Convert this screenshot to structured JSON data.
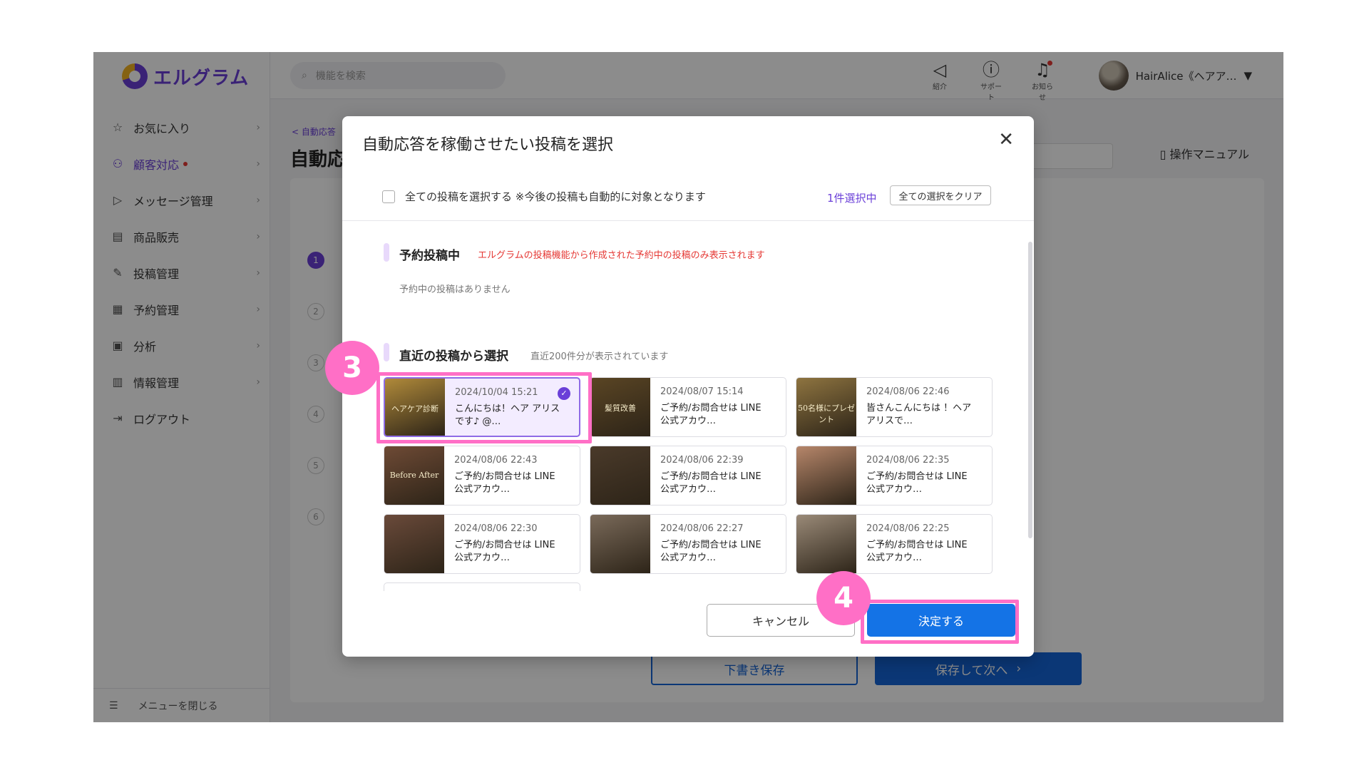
{
  "app": {
    "logo_text": "エルグラム"
  },
  "sidebar": {
    "items": [
      {
        "label": "お気に入り",
        "icon": "star-icon"
      },
      {
        "label": "顧客対応",
        "icon": "person-icon"
      },
      {
        "label": "メッセージ管理",
        "icon": "send-icon"
      },
      {
        "label": "商品販売",
        "icon": "shop-icon"
      },
      {
        "label": "投稿管理",
        "icon": "edit-icon"
      },
      {
        "label": "予約管理",
        "icon": "calendar-icon"
      },
      {
        "label": "分析",
        "icon": "report-icon"
      },
      {
        "label": "情報管理",
        "icon": "bar-chart-icon"
      },
      {
        "label": "ログアウト",
        "icon": "logout-icon"
      }
    ],
    "close_menu": "メニューを閉じる"
  },
  "topbar": {
    "search_placeholder": "機能を検索",
    "icons": [
      {
        "label": "紹介",
        "icon": "megaphone-icon"
      },
      {
        "label": "サポート",
        "icon": "help-icon"
      },
      {
        "label": "お知らせ",
        "icon": "bell-icon"
      }
    ],
    "user_name": "HairAlice《ヘアア…"
  },
  "background": {
    "breadcrumb": "< 自動応答",
    "title": "自動応",
    "manual": "操作マニュアル",
    "steps": [
      "1",
      "2",
      "3",
      "4",
      "5",
      "6"
    ],
    "draft_button": "下書き保存",
    "next_button": "保存して次へ"
  },
  "modal": {
    "title": "自動応答を稼働させたい投稿を選択",
    "select_all_label": "全ての投稿を選択する ※今後の投稿も自動的に対象となります",
    "selected_count": "1件選択中",
    "clear_button": "全ての選択をクリア",
    "scheduled_section": {
      "title": "予約投稿中",
      "note": "エルグラムの投稿機能から作成された予約中の投稿のみ表示されます",
      "empty": "予約中の投稿はありません"
    },
    "recent_section": {
      "title": "直近の投稿から選択",
      "note": "直近200件分が表示されています"
    },
    "posts": [
      {
        "date": "2024/10/04 15:21",
        "text": "こんにちは！ヘア アリスです♪ @…",
        "thumb_label": "ヘアケア診断",
        "selected": true,
        "color": "#b08a3a"
      },
      {
        "date": "2024/08/07 15:14",
        "text": "ご予約/お問合せは LINE公式アカウ…",
        "thumb_label": "髪質改善",
        "selected": false,
        "color": "#5a4524"
      },
      {
        "date": "2024/08/06 22:46",
        "text": "皆さんこんにちは ！ヘアアリスで…",
        "thumb_label": "50名様にプレゼント",
        "selected": false,
        "color": "#8e7440"
      },
      {
        "date": "2024/08/06 22:43",
        "text": "ご予約/お問合せは LINE公式アカウ…",
        "thumb_label": "Before After",
        "selected": false,
        "color": "#6e4a35"
      },
      {
        "date": "2024/08/06 22:39",
        "text": "ご予約/お問合せは LINE公式アカウ…",
        "thumb_label": "",
        "selected": false,
        "color": "#4a3a2a"
      },
      {
        "date": "2024/08/06 22:35",
        "text": "ご予約/お問合せは LINE公式アカウ…",
        "thumb_label": "",
        "selected": false,
        "color": "#b6866a"
      },
      {
        "date": "2024/08/06 22:30",
        "text": "ご予約/お問合せは LINE公式アカウ…",
        "thumb_label": "",
        "selected": false,
        "color": "#6a4a3a"
      },
      {
        "date": "2024/08/06 22:27",
        "text": "ご予約/お問合せは LINE公式アカウ…",
        "thumb_label": "",
        "selected": false,
        "color": "#7a6a5a"
      },
      {
        "date": "2024/08/06 22:25",
        "text": "ご予約/お問合せは LINE公式アカウ…",
        "thumb_label": "",
        "selected": false,
        "color": "#9a8a78"
      }
    ],
    "cancel_button": "キャンセル",
    "ok_button": "決定する"
  },
  "annotations": {
    "badge_3": "3",
    "badge_4": "4",
    "color": "#ff6fc6"
  }
}
